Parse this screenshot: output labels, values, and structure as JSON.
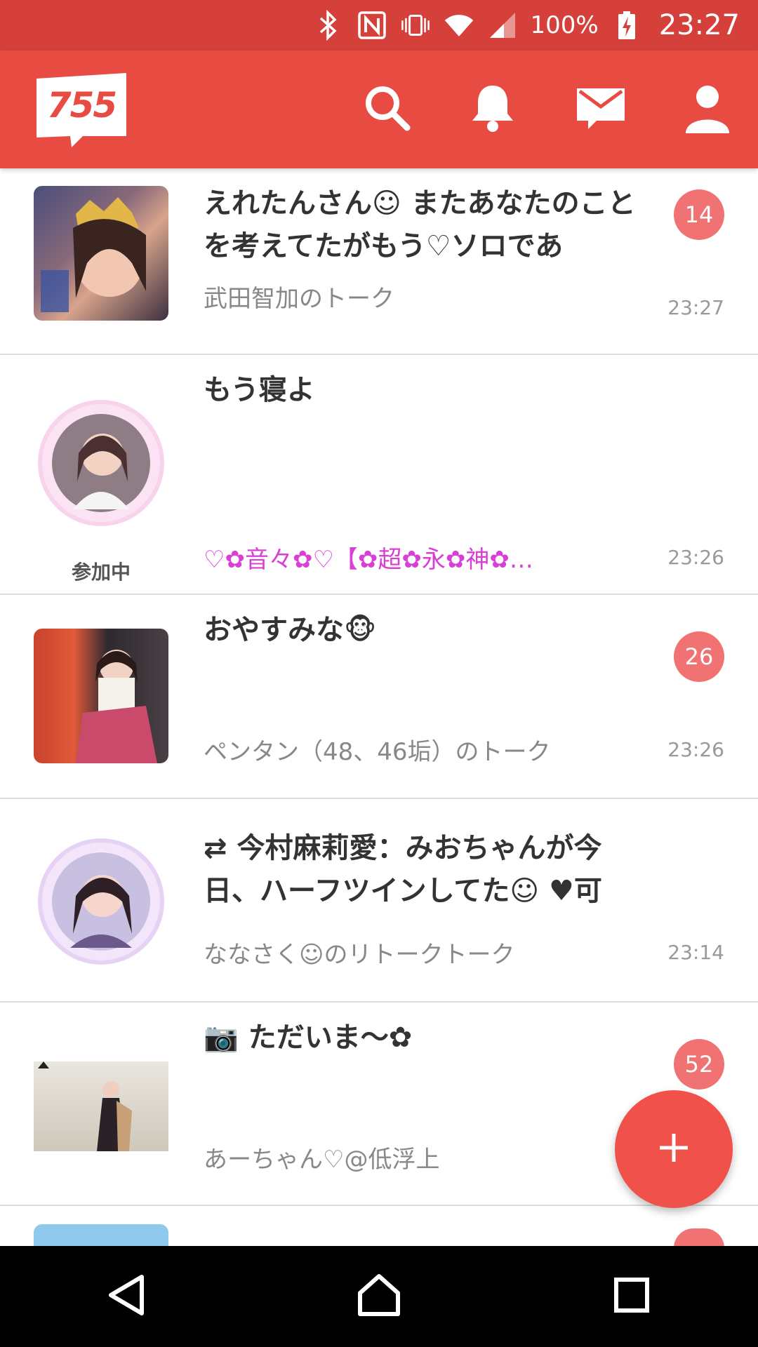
{
  "status_bar": {
    "battery": "100%",
    "time": "23:27"
  },
  "app_bar": {
    "logo": "755",
    "actions": [
      "search-icon",
      "bell-icon",
      "mail-icon",
      "profile-icon"
    ]
  },
  "colors": {
    "header": "#e84b42",
    "badge": "#f07272",
    "fab": "#f0514a"
  },
  "items": [
    {
      "title": "えれたんさん☺ またあなたのことを考えてたがもう♡ソロであ",
      "subtitle": "武田智加のトーク",
      "time": "23:27",
      "badge": "14"
    },
    {
      "title": "もう寝よ",
      "subtitle": "♡✿音々✿♡【✿超✿永✿神✿…",
      "time": "23:26",
      "status": "参加中"
    },
    {
      "title": "おやすみな🐵",
      "subtitle": "ペンタン（48、46垢）のトーク",
      "time": "23:26",
      "badge": "26"
    },
    {
      "title": "⇄ 今村麻莉愛：みおちゃんが今日、ハーフツインしてた☺ ♥可",
      "subtitle": "ななさく☺のリトークトーク",
      "time": "23:14"
    },
    {
      "title": "📷 ただいま〜✿",
      "subtitle": "あーちゃん♡@低浮上",
      "badge": "52"
    }
  ],
  "fab": {
    "label": "+"
  }
}
